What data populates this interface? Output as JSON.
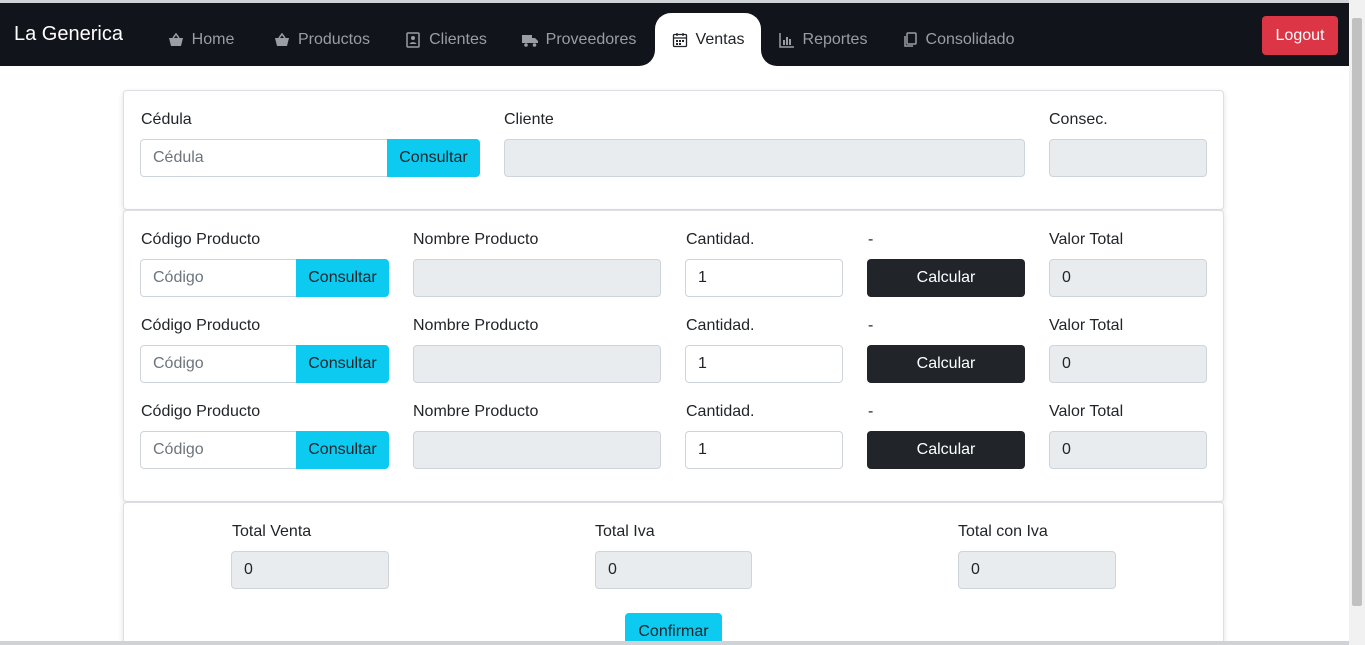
{
  "navbar": {
    "brand": "La Generica",
    "items": [
      {
        "label": "Home",
        "icon": "basket-icon"
      },
      {
        "label": "Productos",
        "icon": "basket-icon"
      },
      {
        "label": "Clientes",
        "icon": "contact-card-icon"
      },
      {
        "label": "Proveedores",
        "icon": "truck-icon"
      },
      {
        "label": "Ventas",
        "icon": "calendar-icon"
      },
      {
        "label": "Reportes",
        "icon": "bar-chart-icon"
      },
      {
        "label": "Consolidado",
        "icon": "copy-icon"
      }
    ],
    "active": "Ventas",
    "logout": "Logout"
  },
  "cliente_section": {
    "cedula_label": "Cédula",
    "cedula_placeholder": "Cédula",
    "consultar": "Consultar",
    "cliente_label": "Cliente",
    "cliente_value": "",
    "consec_label": "Consec.",
    "consec_value": ""
  },
  "products": [
    {
      "codigo_label": "Código Producto",
      "codigo_placeholder": "Código",
      "consultar": "Consultar",
      "nombre_label": "Nombre Producto",
      "nombre_value": "",
      "cantidad_label": "Cantidad.",
      "cantidad_value": "1",
      "dash": "-",
      "calcular": "Calcular",
      "valor_label": "Valor Total",
      "valor_value": "0"
    },
    {
      "codigo_label": "Código Producto",
      "codigo_placeholder": "Código",
      "consultar": "Consultar",
      "nombre_label": "Nombre Producto",
      "nombre_value": "",
      "cantidad_label": "Cantidad.",
      "cantidad_value": "1",
      "dash": "-",
      "calcular": "Calcular",
      "valor_label": "Valor Total",
      "valor_value": "0"
    },
    {
      "codigo_label": "Código Producto",
      "codigo_placeholder": "Código",
      "consultar": "Consultar",
      "nombre_label": "Nombre Producto",
      "nombre_value": "",
      "cantidad_label": "Cantidad.",
      "cantidad_value": "1",
      "dash": "-",
      "calcular": "Calcular",
      "valor_label": "Valor Total",
      "valor_value": "0"
    }
  ],
  "totals": {
    "total_venta_label": "Total Venta",
    "total_venta_value": "0",
    "total_iva_label": "Total Iva",
    "total_iva_value": "0",
    "total_con_iva_label": "Total con Iva",
    "total_con_iva_value": "0",
    "confirmar": "Confirmar"
  },
  "colors": {
    "navbar_bg": "#12141c",
    "logout_red": "#dc3545",
    "info_cyan": "#0dcaf0",
    "dark_button": "#212529"
  }
}
